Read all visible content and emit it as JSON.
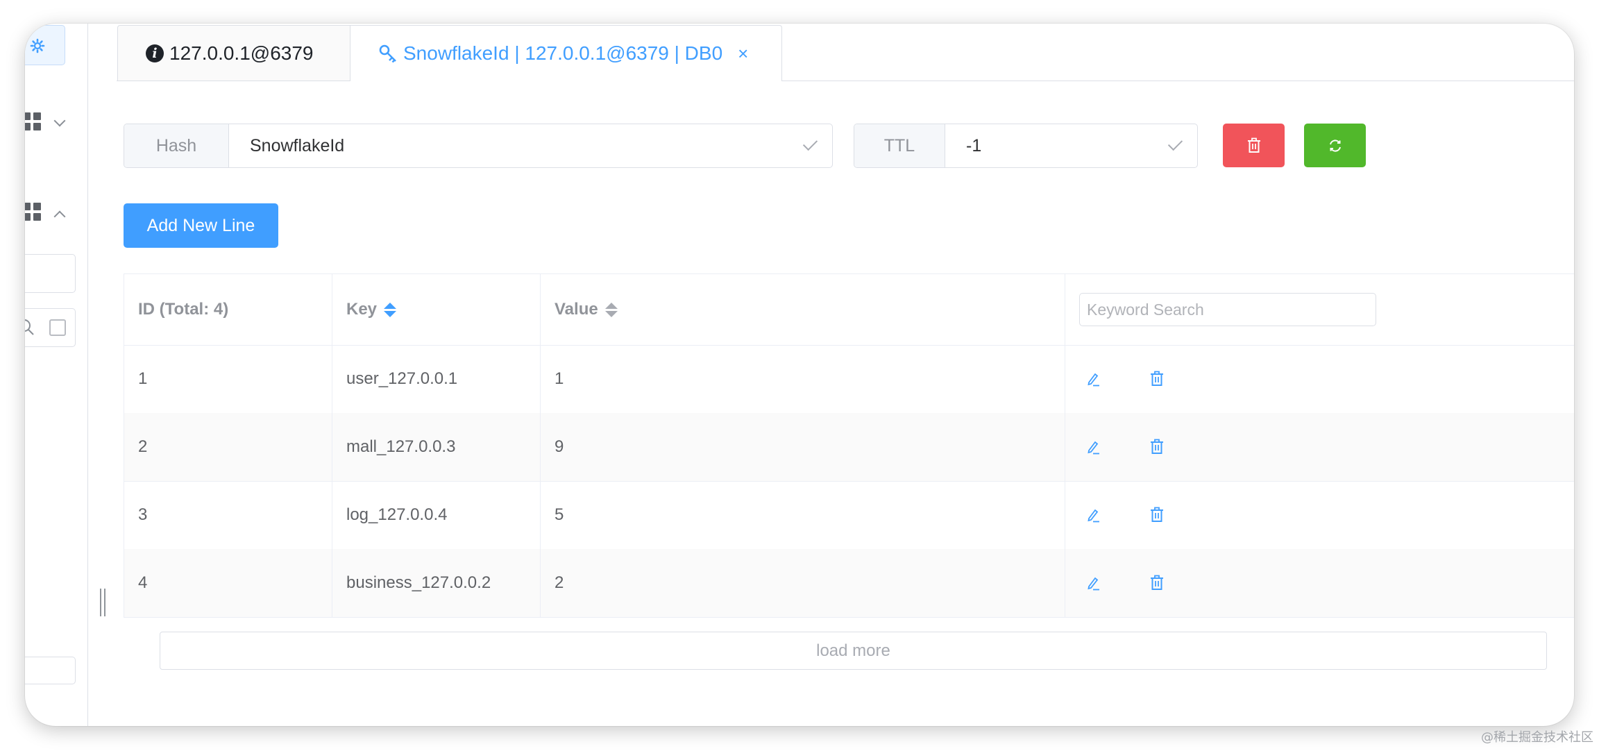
{
  "tabs": [
    {
      "label": "127.0.0.1@6379",
      "icon": "info-icon",
      "active": false
    },
    {
      "label": "SnowflakeId | 127.0.0.1@6379 | DB0",
      "icon": "key-icon",
      "active": true,
      "close": "×"
    }
  ],
  "key_header": {
    "type_label": "Hash",
    "key_name": "SnowflakeId",
    "ttl_label": "TTL",
    "ttl_value": "-1"
  },
  "toolbar": {
    "add_label": "Add New Line"
  },
  "table": {
    "columns": {
      "id": "ID (Total: 4)",
      "key": "Key",
      "value": "Value"
    },
    "search_placeholder": "Keyword Search",
    "rows": [
      {
        "id": "1",
        "key": "user_127.0.0.1",
        "value": "1"
      },
      {
        "id": "2",
        "key": "mall_127.0.0.3",
        "value": "9"
      },
      {
        "id": "3",
        "key": "log_127.0.0.4",
        "value": "5"
      },
      {
        "id": "4",
        "key": "business_127.0.0.2",
        "value": "2"
      }
    ],
    "load_more": "load more"
  },
  "colors": {
    "primary": "#409eff",
    "danger": "#f1545a",
    "success": "#51b82b"
  },
  "watermark": "@稀土掘金技术社区"
}
